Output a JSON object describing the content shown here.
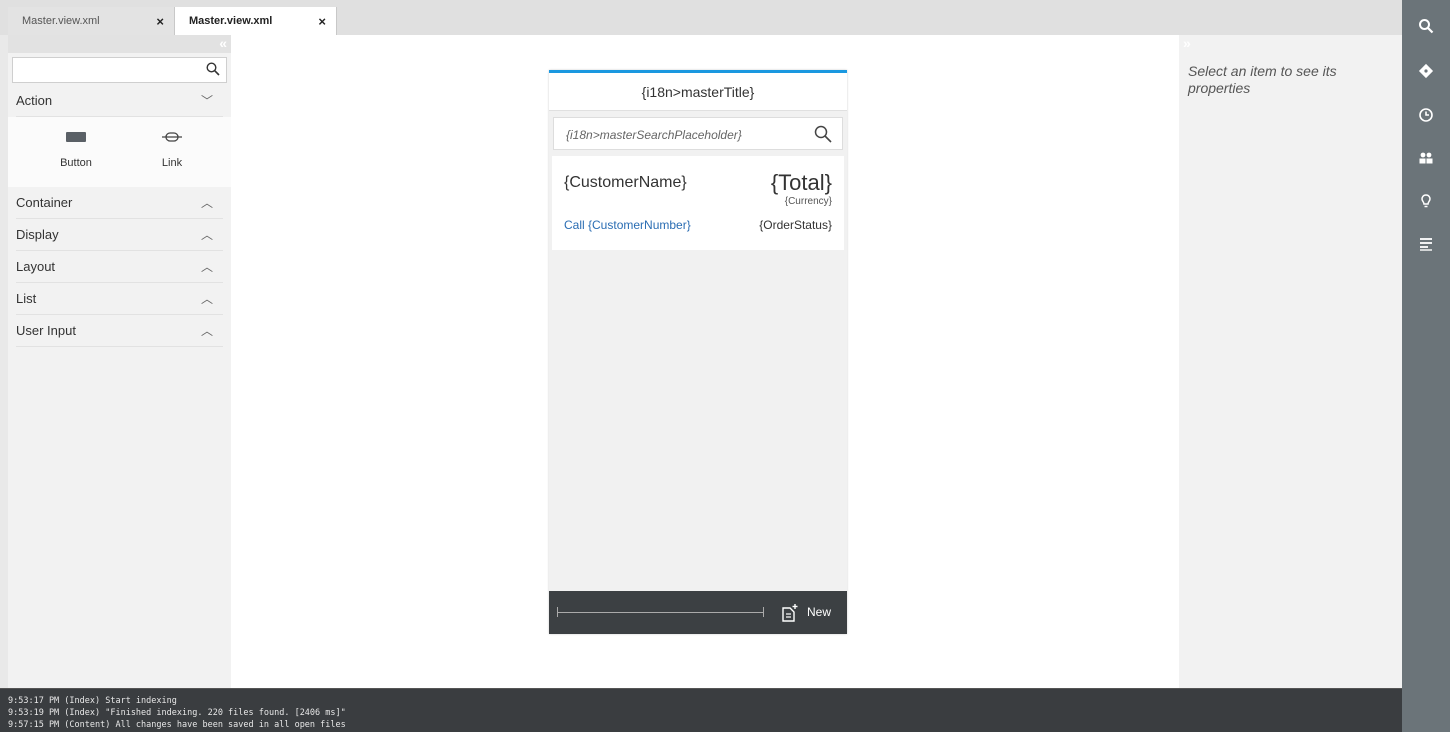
{
  "tabs": [
    {
      "label": "Master.view.xml",
      "close": "×"
    },
    {
      "label": "Master.view.xml",
      "close": "×"
    }
  ],
  "palette": {
    "collapse_glyph": "«",
    "search": {
      "value": "",
      "placeholder": ""
    },
    "categories": [
      {
        "label": "Action",
        "arrow": "﹀"
      },
      {
        "label": "Container",
        "arrow": "︿"
      },
      {
        "label": "Display",
        "arrow": "︿"
      },
      {
        "label": "Layout",
        "arrow": "︿"
      },
      {
        "label": "List",
        "arrow": "︿"
      },
      {
        "label": "User Input",
        "arrow": "︿"
      }
    ],
    "controls": [
      {
        "label": "Button",
        "icon": "button-icon"
      },
      {
        "label": "Link",
        "icon": "link-icon"
      }
    ]
  },
  "device": {
    "title": "{i18n>masterTitle}",
    "search_placeholder": "{i18n>masterSearchPlaceholder}",
    "item": {
      "customer_name": "{CustomerName}",
      "total": "{Total}",
      "currency": "{Currency}",
      "call": "Call {CustomerNumber}",
      "status": "{OrderStatus}"
    },
    "footer": {
      "new_label": "New"
    }
  },
  "props": {
    "expand_glyph": "»",
    "message": "Select an item to see its properties"
  },
  "rail_icons": [
    "search-icon",
    "git-icon",
    "history-icon",
    "collaboration-icon",
    "lightbulb-icon",
    "outline-icon"
  ],
  "console": [
    "9:53:17 PM (Index) Start indexing",
    "9:53:19 PM (Index) \"Finished indexing. 220 files found. [2406 ms]\"",
    "9:57:15 PM (Content) All changes have been saved in all open files"
  ],
  "colors": {
    "accent": "#1a98e0",
    "link": "#2a6db3",
    "rail": "#6b7479",
    "console": "#3a3d40"
  }
}
